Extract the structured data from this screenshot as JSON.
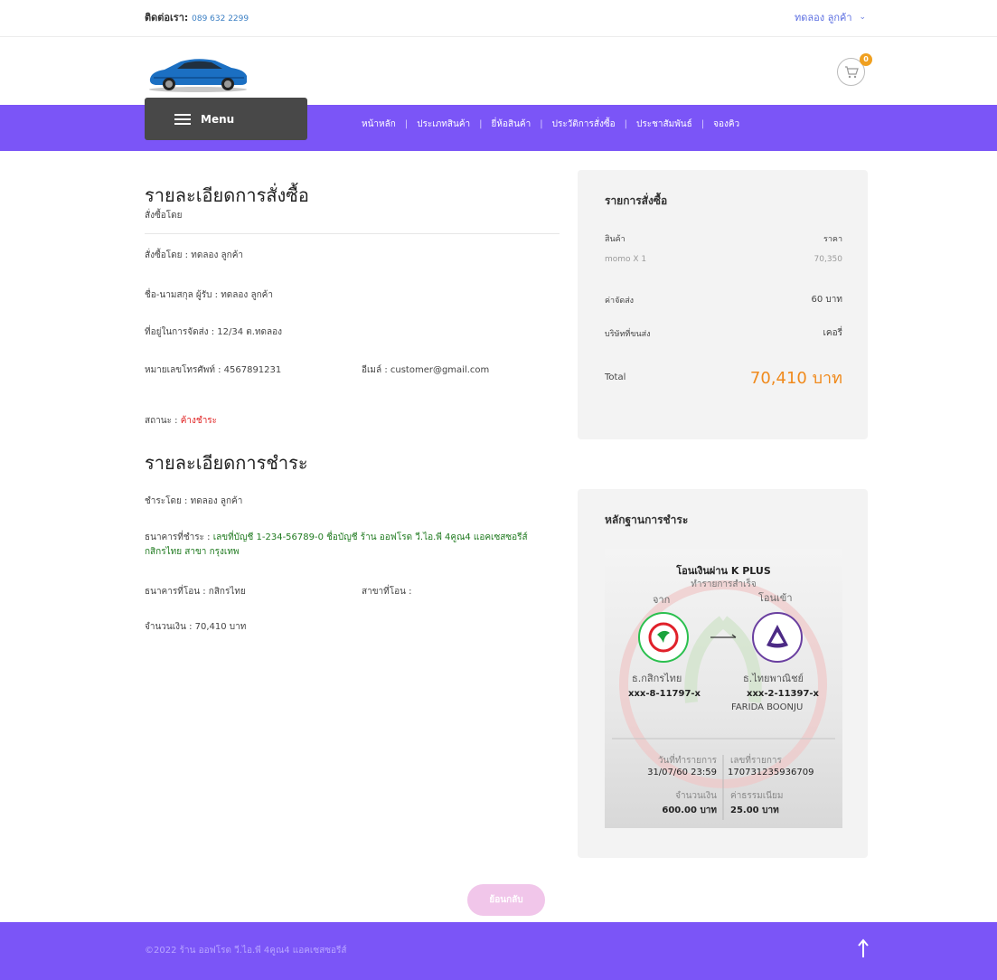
{
  "topbar": {
    "contact_label": "ติดต่อเรา:",
    "contact_phone": "089 632 2299",
    "user_name": "ทดลอง ลูกค้า"
  },
  "cart": {
    "count": "0"
  },
  "nav": {
    "menu_label": "Menu",
    "links": [
      "หน้าหลัก",
      "ประเภทสินค้า",
      "ยี่ห้อสินค้า",
      "ประวัติการสั่งซื้อ",
      "ประชาสัมพันธ์",
      "จองคิว"
    ]
  },
  "order": {
    "title": "รายละเอียดการสั่งซื้อ",
    "subtitle": "สั่งซื้อโดย",
    "ordered_by": "สั่งซื้อโดย : ทดลอง ลูกค้า",
    "recipient": "ชื่อ-นามสกุล ผู้รับ : ทดลอง ลูกค้า",
    "address": "ที่อยู่ในการจัดส่ง : 12/34 ต.ทดลอง",
    "phone": "หมายเลขโทรศัพท์ : 4567891231",
    "email": "อีเมล์ : customer@gmail.com",
    "status_label": "สถานะ :",
    "status_value": "ค้างชำระ",
    "status_color": "#e02020"
  },
  "payment": {
    "title": "รายละเอียดการชำระ",
    "paid_by": "ชำระโดย : ทดลอง ลูกค้า",
    "bank_label": "ธนาคารที่ชำระ :",
    "bank_value_line1": "เลขที่บัญชี 1-234-56789-0 ชื่อบัญชี ร้าน ออฟโรด วี.ไอ.พี 4คูณ4 แอคเซสซอรีส์",
    "bank_value_line2": "กสิกรไทย สาขา กรุงเทพ",
    "transfer_bank": "ธนาคารที่โอน : กสิกรไทย",
    "transfer_branch": "สาขาที่โอน :",
    "amount": "จำนวนเงิน : 70,410 บาท"
  },
  "summary": {
    "title": "รายการสั่งซื้อ",
    "product_header": "สินค้า",
    "price_header": "ราคา",
    "items": [
      {
        "name": "momo X 1",
        "price": "70,350"
      }
    ],
    "shipping_label": "ค่าจัดส่ง",
    "shipping_value": "60 บาท",
    "carrier_label": "บริษัทที่ขนส่ง",
    "carrier_value": "เคอรี่",
    "total_label": "Total",
    "total_value": "70,410 บาท",
    "accent_color": "#f08a1c"
  },
  "proof": {
    "title": "หลักฐานการชำระ",
    "slip": {
      "heading": "โอนเงินผ่าน K PLUS",
      "status": "ทำรายการสำเร็จ",
      "from_label": "จาก",
      "to_label": "โอนเข้า",
      "from_bank": "ธ.กสิกรไทย",
      "from_account": "xxx-8-11797-x",
      "to_bank": "ธ.ไทยพาณิชย์",
      "to_account": "xxx-2-11397-x",
      "to_name": "FARIDA BOONJU",
      "date_label": "วันที่ทำรายการ",
      "date_value": "31/07/60 23:59",
      "ref_label": "เลขที่รายการ",
      "ref_value": "170731235936709",
      "amount_label": "จำนวนเงิน",
      "amount_value": "600.00 บาท",
      "fee_label": "ค่าธรรมเนียม",
      "fee_value": "25.00 บาท"
    }
  },
  "back_button": "ย้อนกลับ",
  "footer": {
    "copyright": "©2022 ร้าน ออฟโรด วี.ไอ.พี 4คูณ4 แอคเซสซอรีส์"
  },
  "colors": {
    "brand": "#7b55f7",
    "menu_bg": "#484848",
    "panel_bg": "#f3f3f3",
    "link": "#5b6ee1"
  }
}
